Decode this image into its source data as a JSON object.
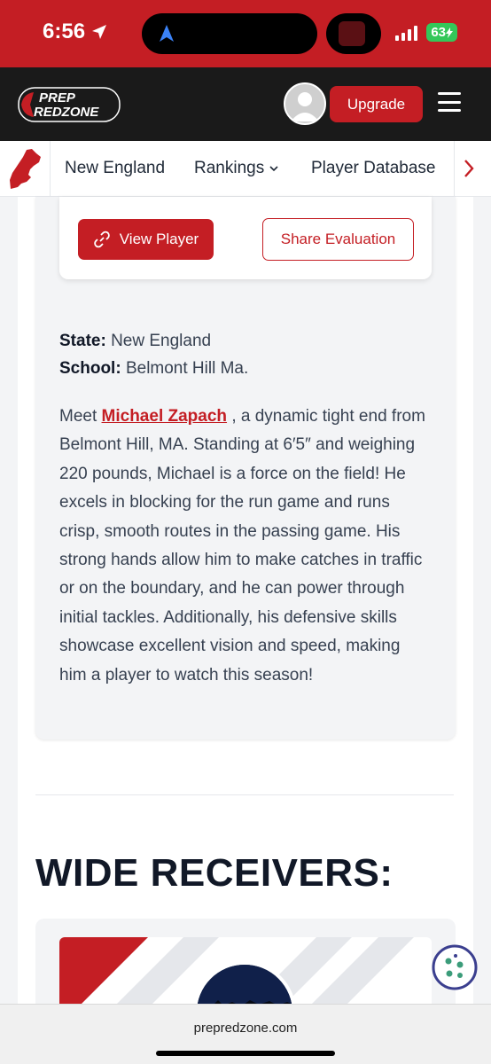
{
  "status_bar": {
    "time": "6:56",
    "battery": "63"
  },
  "header": {
    "logo_top": "PREP",
    "logo_bottom": "REDZONE",
    "upgrade_label": "Upgrade"
  },
  "subnav": {
    "items": [
      "New England",
      "Rankings",
      "Player Database"
    ]
  },
  "evaluation": {
    "view_player_label": "View Player",
    "share_label": "Share Evaluation",
    "state_label": "State:",
    "state_value": "New England",
    "school_label": "School:",
    "school_value": "Belmont Hill Ma.",
    "desc_intro": "Meet",
    "player_name": "Michael Zapach",
    "desc_body": ", a dynamic tight end from Belmont Hill, MA. Standing at 6′5″ and weighing 220 pounds, Michael is a force on the field! He excels in blocking for the run game and runs crisp, smooth routes in the passing game. His strong hands allow him to make catches in traffic or on the boundary, and he can power through initial tackles. Additionally, his defensive skills showcase excellent vision and speed, making him a player to watch this season!"
  },
  "section": {
    "title": "WIDE RECEIVERS:"
  },
  "browser": {
    "url": "prepredzone.com"
  },
  "colors": {
    "brand_red": "#c41e24",
    "header_dark": "#1a1a1a"
  }
}
